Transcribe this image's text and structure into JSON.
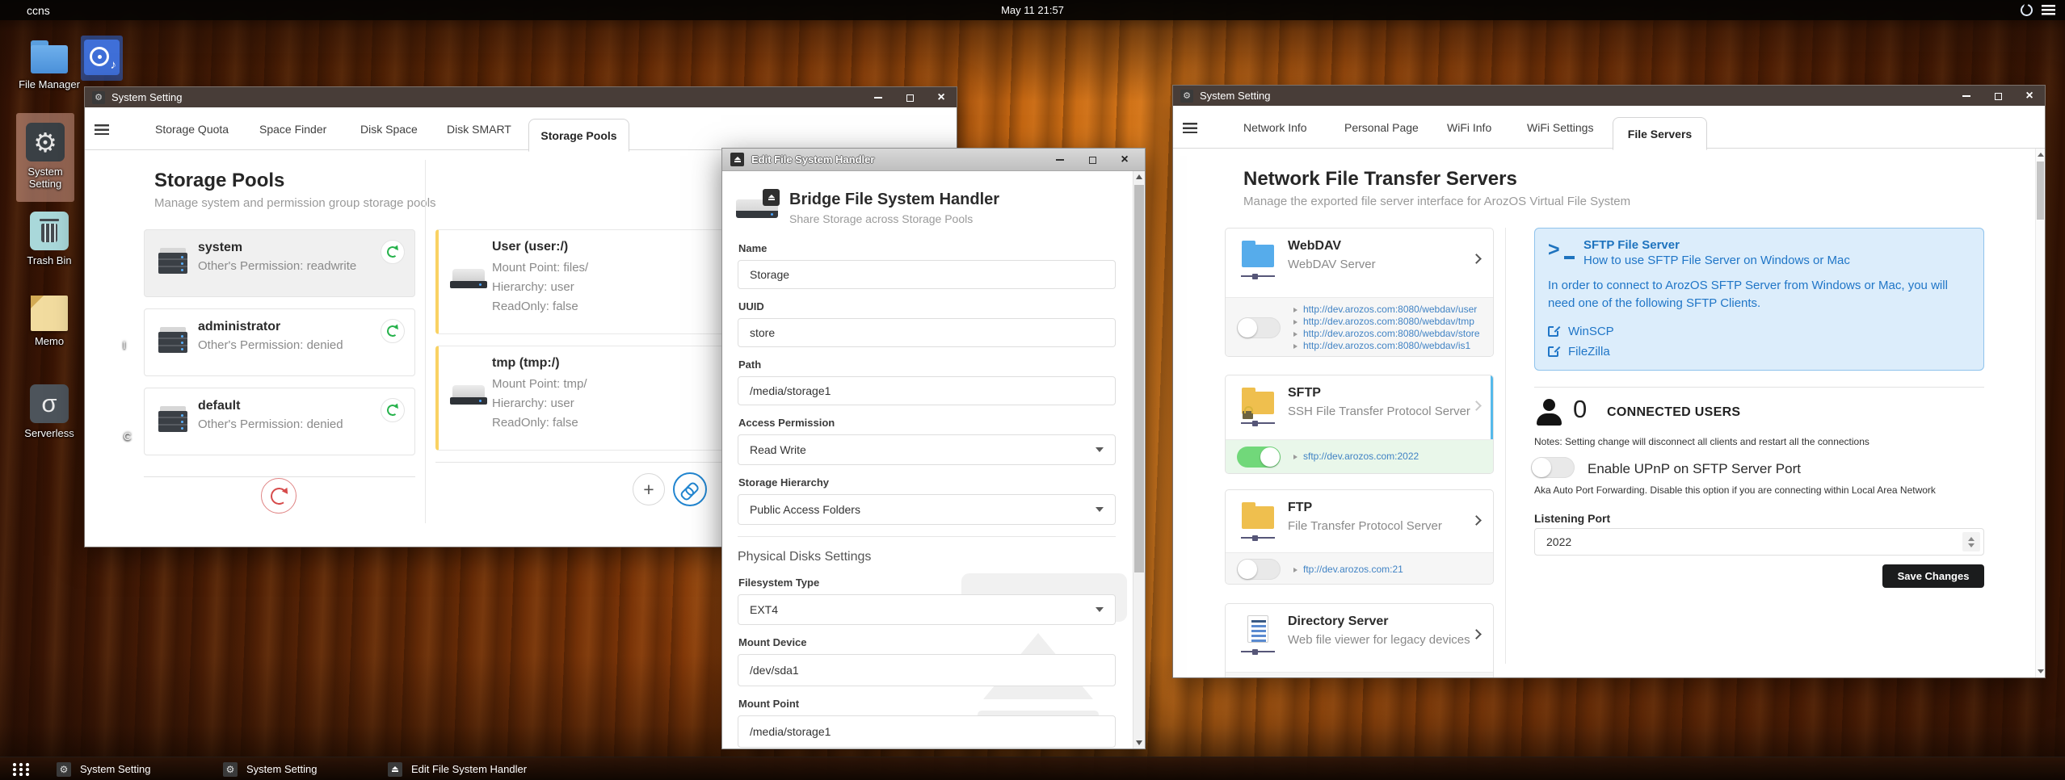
{
  "topbar": {
    "hostname": "ccns",
    "clock": "May 11 21:57"
  },
  "icons_map": {
    "gear": "⚙",
    "music_note": "♪",
    "sigma": "σ",
    "close": "×",
    "plus": "+"
  },
  "desktop": {
    "icons": [
      {
        "label": "File Manager"
      },
      {
        "label": "System Setting"
      },
      {
        "label": "Trash Bin"
      },
      {
        "label": "Memo"
      },
      {
        "label": "Serverless"
      }
    ],
    "partial_labels": {
      "a": "I",
      "b": "C"
    }
  },
  "window_storage": {
    "title": "System Setting",
    "tabs": [
      "Storage Quota",
      "Space Finder",
      "Disk Space",
      "Disk SMART",
      "Storage Pools"
    ],
    "heading": "Storage Pools",
    "subheading": "Manage system and permission group storage pools",
    "pools": [
      {
        "name": "system",
        "permission": "Other's Permission: readwrite"
      },
      {
        "name": "administrator",
        "permission": "Other's Permission: denied"
      },
      {
        "name": "default",
        "permission": "Other's Permission: denied"
      }
    ],
    "bridges": [
      {
        "name": "User (user:/)",
        "mount": "Mount Point: files/",
        "hierarchy": "Hierarchy: user",
        "readonly": "ReadOnly: false"
      },
      {
        "name": "tmp (tmp:/)",
        "mount": "Mount Point: tmp/",
        "hierarchy": "Hierarchy: user",
        "readonly": "ReadOnly: false"
      }
    ]
  },
  "window_edit": {
    "title": "Edit File System Handler",
    "header": {
      "title": "Bridge File System Handler",
      "subtitle": "Share Storage across Storage Pools"
    },
    "section_physical": "Physical Disks Settings",
    "fields": {
      "name": {
        "label": "Name",
        "value": "Storage"
      },
      "uuid": {
        "label": "UUID",
        "value": "store"
      },
      "path": {
        "label": "Path",
        "value": "/media/storage1"
      },
      "access": {
        "label": "Access Permission",
        "value": "Read Write"
      },
      "hierarchy": {
        "label": "Storage Hierarchy",
        "value": "Public Access Folders"
      },
      "fstype": {
        "label": "Filesystem Type",
        "value": "EXT4"
      },
      "mount_device": {
        "label": "Mount Device",
        "value": "/dev/sda1"
      },
      "mount_point": {
        "label": "Mount Point",
        "value": "/media/storage1"
      }
    }
  },
  "window_servers": {
    "title": "System Setting",
    "tabs": [
      "Network Info",
      "Personal Page",
      "WiFi Info",
      "WiFi Settings",
      "File Servers"
    ],
    "heading": "Network File Transfer Servers",
    "subheading": "Manage the exported file server interface for ArozOS Virtual File System",
    "webdav": {
      "name": "WebDAV",
      "desc": "WebDAV Server",
      "links": [
        "http://dev.arozos.com:8080/webdav/user",
        "http://dev.arozos.com:8080/webdav/tmp",
        "http://dev.arozos.com:8080/webdav/store",
        "http://dev.arozos.com:8080/webdav/is1"
      ]
    },
    "sftp": {
      "name": "SFTP",
      "desc": "SSH File Transfer Protocol Server",
      "link": "sftp://dev.arozos.com:2022"
    },
    "ftp": {
      "name": "FTP",
      "desc": "File Transfer Protocol Server",
      "link": "ftp://dev.arozos.com:21"
    },
    "dirserver": {
      "name": "Directory Server",
      "desc": "Web file viewer for legacy devices"
    },
    "info": {
      "title": "SFTP File Server",
      "subtitle": "How to use SFTP File Server on Windows or Mac",
      "body": "In order to connect to ArozOS SFTP Server from Windows or Mac, you will need one of the following SFTP Clients.",
      "clients": [
        "WinSCP",
        "FileZilla"
      ]
    },
    "connected": {
      "count": "0",
      "label": "CONNECTED USERS",
      "notes": "Notes: Setting change will disconnect all clients and restart all the connections"
    },
    "upnp": {
      "label": "Enable UPnP on SFTP Server Port",
      "desc": "Aka Auto Port Forwarding. Disable this option if you are connecting within Local Area Network"
    },
    "port": {
      "label": "Listening Port",
      "value": "2022"
    },
    "save_label": "Save Changes"
  },
  "taskbar": {
    "items": [
      {
        "label": "System Setting"
      },
      {
        "label": "System Setting"
      },
      {
        "label": "Edit File System Handler"
      }
    ]
  },
  "colors": {
    "accent_blue": "#2185d0",
    "toggle_green": "#71d87a",
    "link_blue": "#4183c4",
    "info_blue": "#2076c7",
    "save_black": "#1b1c1d",
    "yellow_border": "#f9d263",
    "refresh_green": "#26b24b",
    "refresh_red": "#d64b4b"
  }
}
